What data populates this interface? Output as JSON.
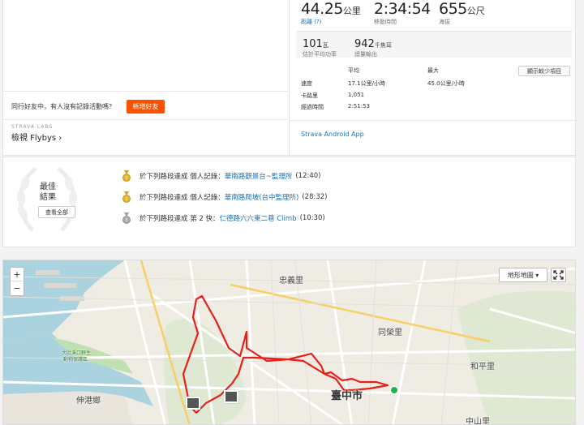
{
  "summary": {
    "distance": {
      "value": "44.25",
      "unit": "公里",
      "label": "距離 (?)"
    },
    "moving_time": {
      "value": "2:34:54",
      "label": "移動時間"
    },
    "elevation": {
      "value": "655",
      "unit": "公尺",
      "label": "海拔"
    },
    "power": {
      "value": "101",
      "unit": "瓦",
      "label": "估計平均功率"
    },
    "energy": {
      "value": "942",
      "unit": "千焦耳",
      "label": "總量輸出"
    }
  },
  "table": {
    "col_avg": "平均",
    "col_max": "最大",
    "rows": [
      {
        "label": "速度",
        "avg": "17.1公里/小時",
        "max": "45.0公里/小時"
      },
      {
        "label": "卡路里",
        "avg": "1,051",
        "max": ""
      },
      {
        "label": "經過時間",
        "avg": "2:51:53",
        "max": ""
      }
    ],
    "show_fewer": "顯示較少項目"
  },
  "app_link": "Strava Android App",
  "friends": {
    "message": "同行好友中，有人沒有記錄活動嗎？",
    "add_button": "新增好友"
  },
  "labs": {
    "header": "STRAVA LABS",
    "flybys": "檢視 Flybys ›"
  },
  "achievements": {
    "title_line1": "最佳",
    "title_line2": "結果",
    "see_all": "查看全部",
    "items": [
      {
        "prefix": "於下列路段達成 個人記錄：",
        "segment": "華南路觀景台~監理所",
        "time": "(12:40)",
        "medal": "gold"
      },
      {
        "prefix": "於下列路段達成 個人記錄：",
        "segment": "華南路爬坡(台中監理所)",
        "time": "(28:32)",
        "medal": "gold"
      },
      {
        "prefix": "於下列路段達成 第 2 快：",
        "segment": "仁德路六六東二巷 Climb",
        "time": "(10:30)",
        "medal": "silver"
      }
    ]
  },
  "map": {
    "type_label": "地形地圖 ▾",
    "zoom_in": "+",
    "zoom_out": "−",
    "places": {
      "zhongyi": "忠義里",
      "tongrong": "同榮里",
      "heping": "和平里",
      "shengang": "伸港鄉",
      "taichung": "臺中市",
      "zhongshan": "中山里",
      "wetland1": "大肚溪口野生",
      "wetland2": "動物保護區"
    },
    "route_color": "#e8201a",
    "end_marker_color": "#22b14c"
  }
}
